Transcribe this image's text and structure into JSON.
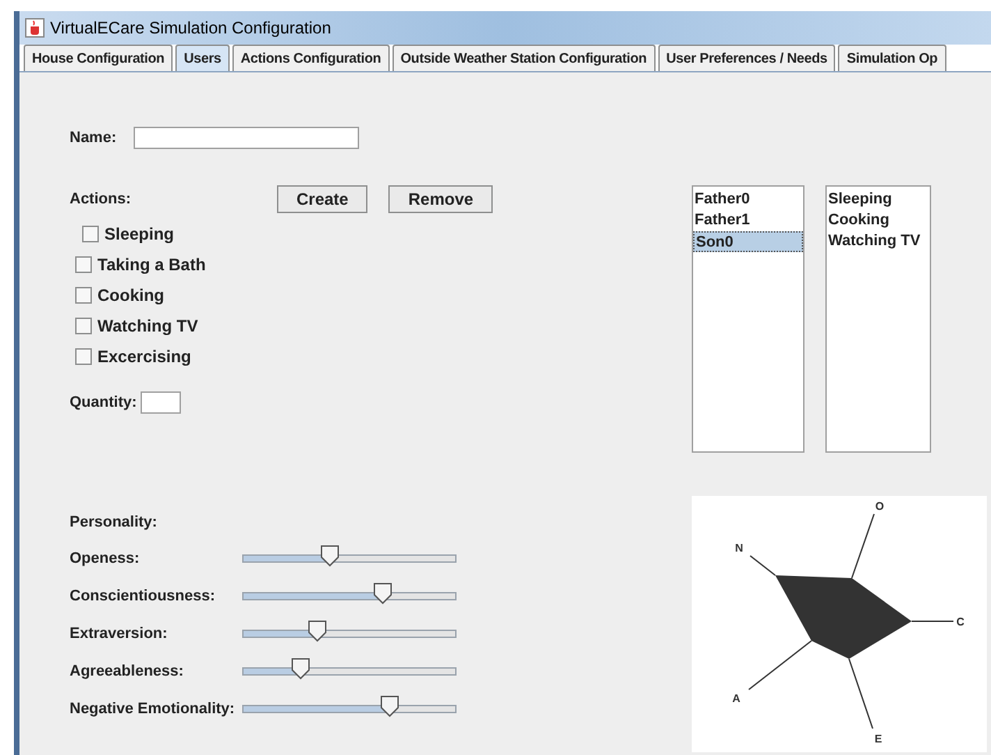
{
  "window": {
    "title": "VirtualECare Simulation Configuration"
  },
  "tabs": [
    {
      "label": "House Configuration",
      "selected": false
    },
    {
      "label": "Users",
      "selected": true
    },
    {
      "label": "Actions Configuration",
      "selected": false
    },
    {
      "label": "Outside Weather Station Configuration",
      "selected": false
    },
    {
      "label": "User Preferences / Needs",
      "selected": false
    },
    {
      "label": "Simulation Op",
      "selected": false
    }
  ],
  "name_field": {
    "label": "Name:"
  },
  "actions": {
    "label": "Actions:",
    "buttons": [
      "Create",
      "Remove"
    ],
    "checkboxes": [
      {
        "label": "Sleeping",
        "checked": false
      },
      {
        "label": "Taking a Bath",
        "checked": false
      },
      {
        "label": "Cooking",
        "checked": false
      },
      {
        "label": "Watching TV",
        "checked": false
      },
      {
        "label": "Excercising",
        "checked": false
      }
    ]
  },
  "quantity": {
    "label": "Quantity:"
  },
  "users_list": [
    {
      "label": "Father0",
      "selected": false
    },
    {
      "label": "Father1",
      "selected": false
    },
    {
      "label": "Son0",
      "selected": true
    }
  ],
  "user_actions_list": [
    "Sleeping",
    "Cooking",
    "Watching TV"
  ],
  "personality": {
    "label": "Personality:",
    "traits": [
      {
        "label": "Openess:",
        "level": 0.41
      },
      {
        "label": "Conscientiousness:",
        "level": 0.66
      },
      {
        "label": "Extraversion:",
        "level": 0.35
      },
      {
        "label": "Agreeableness:",
        "level": 0.27
      },
      {
        "label": "Negative Emotionality:",
        "level": 0.69
      }
    ]
  },
  "radar": {
    "axes": [
      "O",
      "C",
      "E",
      "A",
      "N"
    ]
  }
}
